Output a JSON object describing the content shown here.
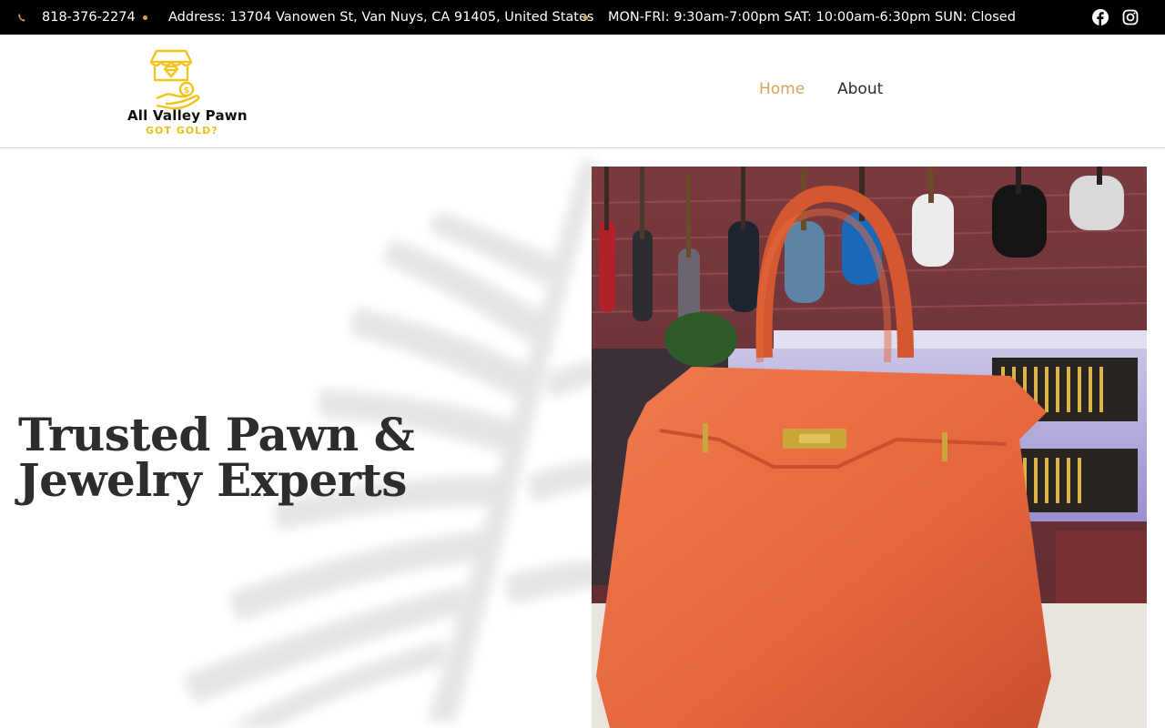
{
  "topbar": {
    "phone": "818-376-2274",
    "address": "Address: 13704 Vanowen St, Van Nuys, CA 91405, United States",
    "hours": "MON-FRI: 9:30am-7:00pm SAT: 10:00am-6:30pm SUN: Closed",
    "accent_color": "#e0a04a",
    "icons": [
      "phone-icon",
      "facebook-icon",
      "instagram-icon"
    ]
  },
  "logo": {
    "title": "All Valley Pawn",
    "tagline": "GOT GOLD?",
    "accent_color": "#f2c318"
  },
  "nav": {
    "items": [
      {
        "label": "Home",
        "active": true
      },
      {
        "label": "About",
        "active": false
      }
    ],
    "active_color": "#d9a35c"
  },
  "hero": {
    "headline_line1": "Trusted Pawn &",
    "headline_line2": "Jewelry Experts",
    "image_subject": "orange handbag in pawn shop with guitars"
  }
}
